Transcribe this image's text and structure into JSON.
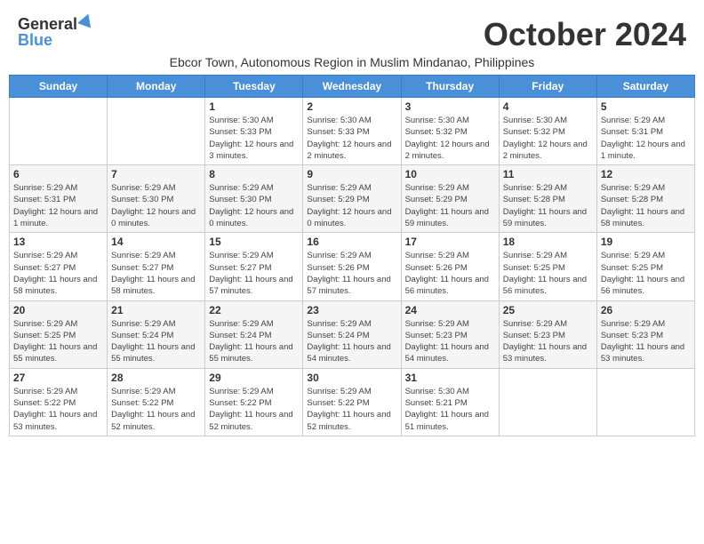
{
  "header": {
    "logo_general": "General",
    "logo_blue": "Blue",
    "month": "October 2024",
    "subtitle": "Ebcor Town, Autonomous Region in Muslim Mindanao, Philippines"
  },
  "weekdays": [
    "Sunday",
    "Monday",
    "Tuesday",
    "Wednesday",
    "Thursday",
    "Friday",
    "Saturday"
  ],
  "weeks": [
    [
      {
        "day": "",
        "info": ""
      },
      {
        "day": "",
        "info": ""
      },
      {
        "day": "1",
        "info": "Sunrise: 5:30 AM\nSunset: 5:33 PM\nDaylight: 12 hours and 3 minutes."
      },
      {
        "day": "2",
        "info": "Sunrise: 5:30 AM\nSunset: 5:33 PM\nDaylight: 12 hours and 2 minutes."
      },
      {
        "day": "3",
        "info": "Sunrise: 5:30 AM\nSunset: 5:32 PM\nDaylight: 12 hours and 2 minutes."
      },
      {
        "day": "4",
        "info": "Sunrise: 5:30 AM\nSunset: 5:32 PM\nDaylight: 12 hours and 2 minutes."
      },
      {
        "day": "5",
        "info": "Sunrise: 5:29 AM\nSunset: 5:31 PM\nDaylight: 12 hours and 1 minute."
      }
    ],
    [
      {
        "day": "6",
        "info": "Sunrise: 5:29 AM\nSunset: 5:31 PM\nDaylight: 12 hours and 1 minute."
      },
      {
        "day": "7",
        "info": "Sunrise: 5:29 AM\nSunset: 5:30 PM\nDaylight: 12 hours and 0 minutes."
      },
      {
        "day": "8",
        "info": "Sunrise: 5:29 AM\nSunset: 5:30 PM\nDaylight: 12 hours and 0 minutes."
      },
      {
        "day": "9",
        "info": "Sunrise: 5:29 AM\nSunset: 5:29 PM\nDaylight: 12 hours and 0 minutes."
      },
      {
        "day": "10",
        "info": "Sunrise: 5:29 AM\nSunset: 5:29 PM\nDaylight: 11 hours and 59 minutes."
      },
      {
        "day": "11",
        "info": "Sunrise: 5:29 AM\nSunset: 5:28 PM\nDaylight: 11 hours and 59 minutes."
      },
      {
        "day": "12",
        "info": "Sunrise: 5:29 AM\nSunset: 5:28 PM\nDaylight: 11 hours and 58 minutes."
      }
    ],
    [
      {
        "day": "13",
        "info": "Sunrise: 5:29 AM\nSunset: 5:27 PM\nDaylight: 11 hours and 58 minutes."
      },
      {
        "day": "14",
        "info": "Sunrise: 5:29 AM\nSunset: 5:27 PM\nDaylight: 11 hours and 58 minutes."
      },
      {
        "day": "15",
        "info": "Sunrise: 5:29 AM\nSunset: 5:27 PM\nDaylight: 11 hours and 57 minutes."
      },
      {
        "day": "16",
        "info": "Sunrise: 5:29 AM\nSunset: 5:26 PM\nDaylight: 11 hours and 57 minutes."
      },
      {
        "day": "17",
        "info": "Sunrise: 5:29 AM\nSunset: 5:26 PM\nDaylight: 11 hours and 56 minutes."
      },
      {
        "day": "18",
        "info": "Sunrise: 5:29 AM\nSunset: 5:25 PM\nDaylight: 11 hours and 56 minutes."
      },
      {
        "day": "19",
        "info": "Sunrise: 5:29 AM\nSunset: 5:25 PM\nDaylight: 11 hours and 56 minutes."
      }
    ],
    [
      {
        "day": "20",
        "info": "Sunrise: 5:29 AM\nSunset: 5:25 PM\nDaylight: 11 hours and 55 minutes."
      },
      {
        "day": "21",
        "info": "Sunrise: 5:29 AM\nSunset: 5:24 PM\nDaylight: 11 hours and 55 minutes."
      },
      {
        "day": "22",
        "info": "Sunrise: 5:29 AM\nSunset: 5:24 PM\nDaylight: 11 hours and 55 minutes."
      },
      {
        "day": "23",
        "info": "Sunrise: 5:29 AM\nSunset: 5:24 PM\nDaylight: 11 hours and 54 minutes."
      },
      {
        "day": "24",
        "info": "Sunrise: 5:29 AM\nSunset: 5:23 PM\nDaylight: 11 hours and 54 minutes."
      },
      {
        "day": "25",
        "info": "Sunrise: 5:29 AM\nSunset: 5:23 PM\nDaylight: 11 hours and 53 minutes."
      },
      {
        "day": "26",
        "info": "Sunrise: 5:29 AM\nSunset: 5:23 PM\nDaylight: 11 hours and 53 minutes."
      }
    ],
    [
      {
        "day": "27",
        "info": "Sunrise: 5:29 AM\nSunset: 5:22 PM\nDaylight: 11 hours and 53 minutes."
      },
      {
        "day": "28",
        "info": "Sunrise: 5:29 AM\nSunset: 5:22 PM\nDaylight: 11 hours and 52 minutes."
      },
      {
        "day": "29",
        "info": "Sunrise: 5:29 AM\nSunset: 5:22 PM\nDaylight: 11 hours and 52 minutes."
      },
      {
        "day": "30",
        "info": "Sunrise: 5:29 AM\nSunset: 5:22 PM\nDaylight: 11 hours and 52 minutes."
      },
      {
        "day": "31",
        "info": "Sunrise: 5:30 AM\nSunset: 5:21 PM\nDaylight: 11 hours and 51 minutes."
      },
      {
        "day": "",
        "info": ""
      },
      {
        "day": "",
        "info": ""
      }
    ]
  ]
}
